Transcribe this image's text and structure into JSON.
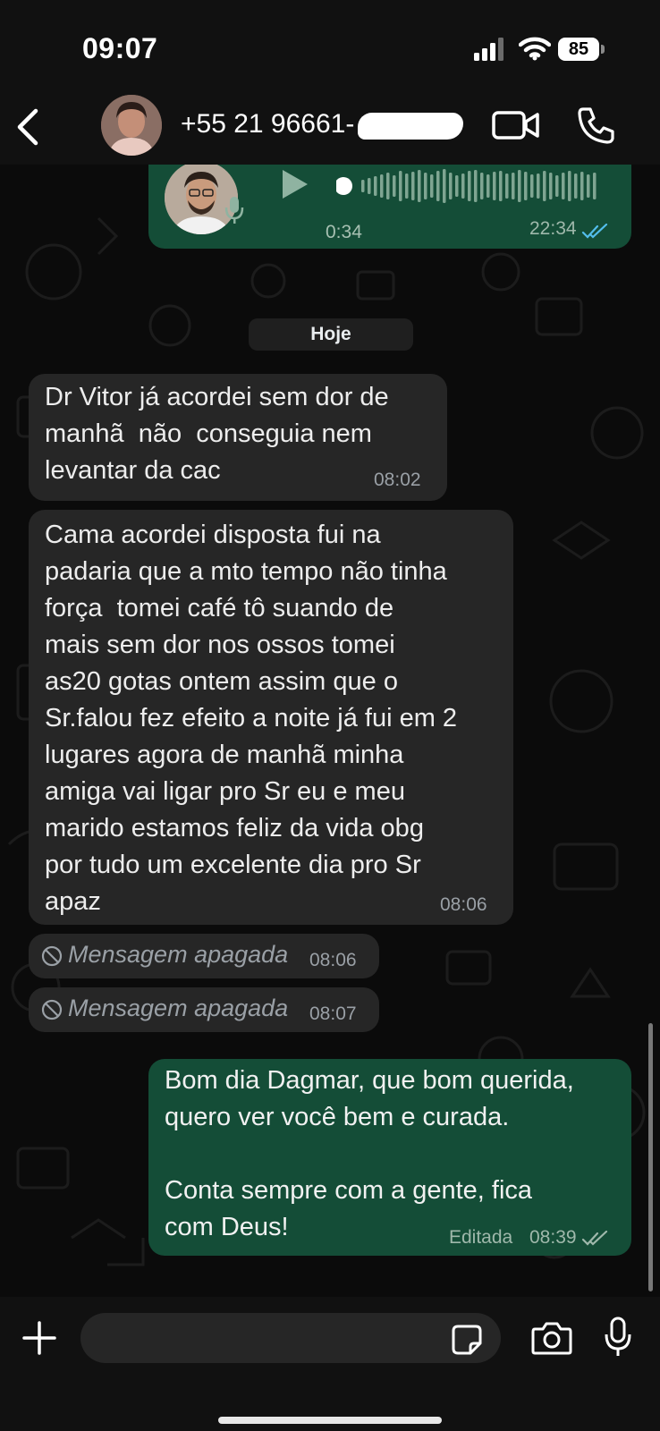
{
  "status_bar": {
    "time": "09:07",
    "battery": "85"
  },
  "header": {
    "contact": "+55 21 96661-",
    "icons": [
      "back-chevron-icon",
      "video-call-icon",
      "phone-icon"
    ]
  },
  "voice_message": {
    "duration": "0:34",
    "time": "22:34",
    "status": "read"
  },
  "day_separator": "Hoje",
  "messages": [
    {
      "direction": "incoming",
      "text": "Dr Vitor já acordei sem dor de\nmanhã  não  conseguia nem\nlevantar da cac",
      "time": "08:02"
    },
    {
      "direction": "incoming",
      "text": "Cama acordei disposta fui na\npadaria que a mto tempo não tinha\nforça  tomei café tô suando de\nmais sem dor nos ossos tomei\nas20 gotas ontem assim que o\nSr.falou fez efeito a noite já fui em 2\nlugares agora de manhã minha\namiga vai ligar pro Sr eu e meu\nmarido estamos feliz da vida obg\npor tudo um excelente dia pro Sr\napaz",
      "time": "08:06"
    },
    {
      "direction": "incoming",
      "deleted": true,
      "text": "Mensagem apagada",
      "time": "08:06"
    },
    {
      "direction": "incoming",
      "deleted": true,
      "text": "Mensagem apagada",
      "time": "08:07"
    },
    {
      "direction": "outgoing",
      "text": "Bom dia Dagmar, que bom querida,\nquero ver você bem e curada.\n\nConta sempre com a gente, fica\ncom Deus!",
      "edited_label": "Editada",
      "time": "08:39",
      "status": "delivered"
    }
  ],
  "composer": {
    "placeholder": "",
    "icons": [
      "plus-icon",
      "sticker-icon",
      "camera-icon",
      "mic-icon"
    ]
  },
  "colors": {
    "outgoing_bubble": "#144d37",
    "incoming_bubble": "#262626",
    "read_ticks": "#53bdeb",
    "background": "#0b0b0b"
  }
}
